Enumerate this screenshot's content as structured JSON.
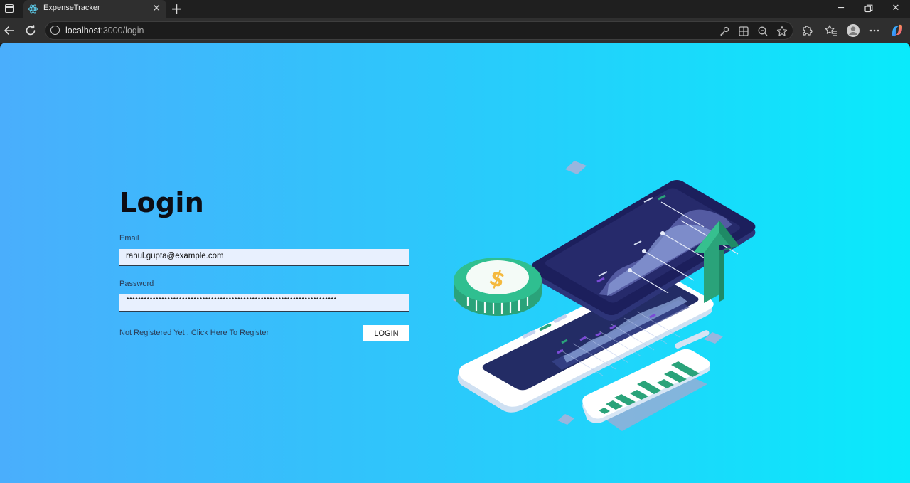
{
  "browser": {
    "tab_title": "ExpenseTracker",
    "url_host": "localhost",
    "url_path": ":3000/login"
  },
  "login": {
    "title": "Login",
    "email_label": "Email",
    "email_value": "rahul.gupta@example.com",
    "password_label": "Password",
    "password_masked": "••••••••••••••••••••••••••••••••••••••••••••••••••••••••••••••••••••••••",
    "register_link": "Not Registered Yet , Click Here To Register",
    "login_button": "LOGIN"
  },
  "icons": {
    "window_menu": "window-icon",
    "favicon": "react-icon",
    "back": "back-arrow-icon",
    "reload": "reload-icon",
    "site_info": "info-icon",
    "key": "key-icon",
    "apps": "apps-icon",
    "zoom": "zoom-out-icon",
    "favorite": "star-icon",
    "extensions": "puzzle-icon",
    "favorites": "favorites-icon",
    "profile": "avatar-icon",
    "more": "more-icon",
    "copilot": "copilot-icon",
    "illustration": "finance-phone-illustration"
  },
  "colors": {
    "gradient_start": "#4aaefc",
    "gradient_end": "#09eafb",
    "login_button_bg": "#ffffff",
    "field_bg": "#e8f0fe"
  }
}
